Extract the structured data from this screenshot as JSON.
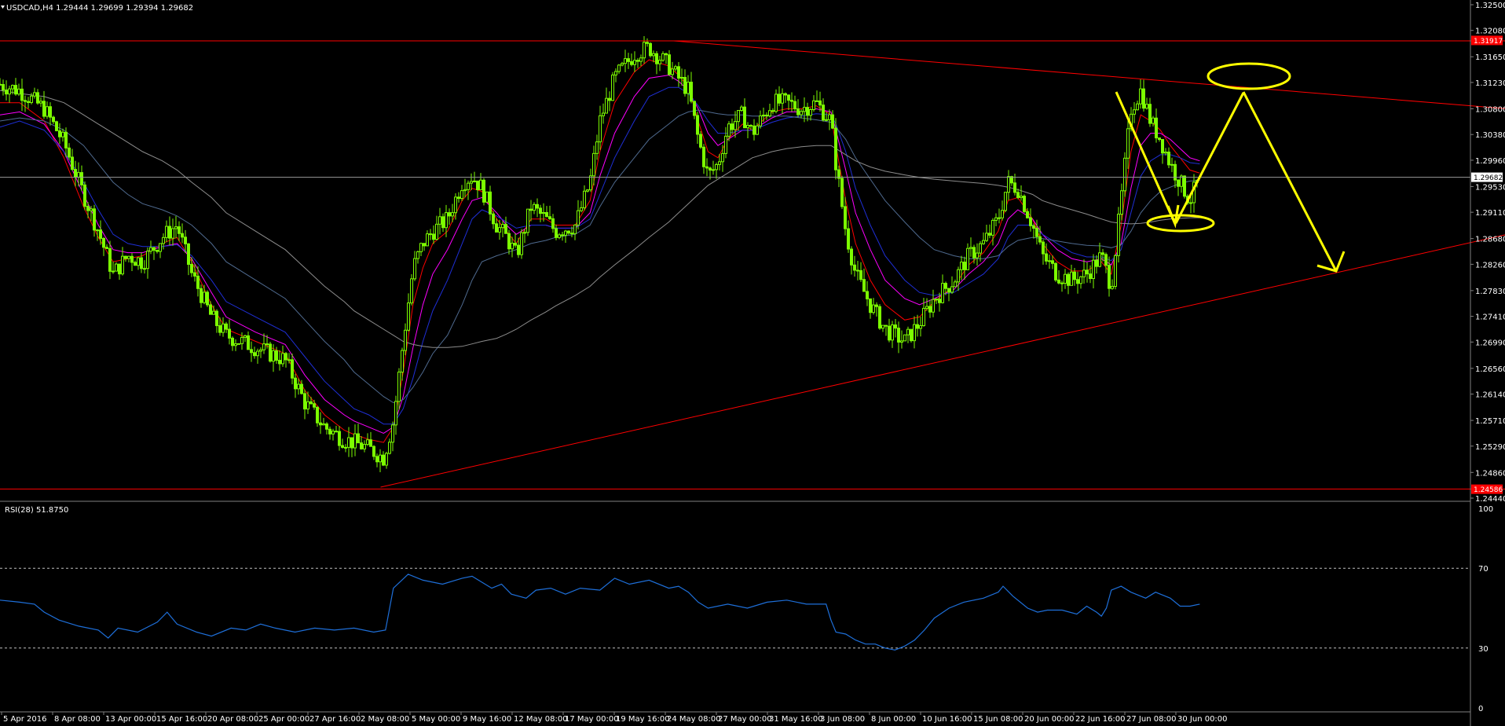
{
  "header": {
    "symbol_info": "USDCAD,H4  1.29444 1.29699 1.29394 1.29682",
    "rsi_info": "RSI(28) 51.8750"
  },
  "colors": {
    "background": "#000000",
    "candle": "#7cfc00",
    "ma_fast": "#ffff00",
    "ma_red": "#ff0000",
    "ma_magenta": "#ff00ff",
    "ma_blue": "#1f2fd6",
    "ma_slate": "#4f6a8f",
    "ma_gray": "#8c8c8c",
    "trendline": "#ff0000",
    "annotation": "#ffff00",
    "rsi": "#1e6fd9",
    "axis": "#808080",
    "price_box": "#ffffff",
    "level_box": "#ff0000"
  },
  "chart_data": [
    {
      "type": "line",
      "title": "USDCAD,H4",
      "ylim": [
        1.2444,
        1.325
      ],
      "yticks": [
        "1.32500",
        "1.32080",
        "1.31650",
        "1.31230",
        "1.30800",
        "1.30380",
        "1.29960",
        "1.29530",
        "1.29110",
        "1.28680",
        "1.28260",
        "1.27830",
        "1.27410",
        "1.26990",
        "1.26560",
        "1.26140",
        "1.25710",
        "1.25290",
        "1.24860",
        "1.24440"
      ],
      "xticks": [
        "5 Apr 2016",
        "8 Apr 08:00",
        "13 Apr 00:00",
        "15 Apr 16:00",
        "20 Apr 08:00",
        "25 Apr 00:00",
        "27 Apr 16:00",
        "2 May 08:00",
        "5 May 00:00",
        "9 May 16:00",
        "12 May 08:00",
        "17 May 00:00",
        "19 May 16:00",
        "24 May 08:00",
        "27 May 00:00",
        "31 May 16:00",
        "3 Jun 08:00",
        "8 Jun 00:00",
        "10 Jun 16:00",
        "15 Jun 08:00",
        "20 Jun 00:00",
        "22 Jun 16:00",
        "27 Jun 08:00",
        "30 Jun 00:00"
      ],
      "current_price_label": "1.29682",
      "upper_level_label": "1.31917",
      "lower_level_label": "1.24586",
      "price_path": {
        "x": [
          0,
          20,
          45,
          65,
          85,
          100,
          115,
          130,
          145,
          165,
          180,
          195,
          215,
          230,
          260,
          290,
          310,
          330,
          350,
          360,
          375,
          390,
          400,
          410,
          420,
          430,
          440,
          455,
          470,
          480,
          490,
          505,
          515,
          525,
          540,
          555,
          565,
          585,
          600,
          610,
          625,
          645,
          660,
          680,
          690,
          700,
          710,
          720,
          730,
          740,
          755,
          765,
          785,
          800,
          815,
          830,
          845,
          850,
          860,
          870,
          885,
          900,
          920,
          935,
          950,
          970,
          985,
          1000,
          1015,
          1025,
          1035,
          1050,
          1060,
          1075,
          1090,
          1105,
          1120,
          1130,
          1140,
          1150,
          1160,
          1170,
          1180,
          1190,
          1200,
          1210,
          1220
        ],
        "y": [
          1.312,
          1.311,
          1.308,
          1.3025,
          1.294,
          1.288,
          1.281,
          1.284,
          1.283,
          1.287,
          1.289,
          1.281,
          1.274,
          1.271,
          1.269,
          1.267,
          1.26,
          1.256,
          1.254,
          1.2535,
          1.2525,
          1.251,
          1.257,
          1.27,
          1.282,
          1.286,
          1.288,
          1.29,
          1.296,
          1.297,
          1.295,
          1.289,
          1.287,
          1.284,
          1.292,
          1.29,
          1.288,
          1.289,
          1.296,
          1.306,
          1.313,
          1.317,
          1.318,
          1.315,
          1.313,
          1.311,
          1.303,
          1.297,
          1.299,
          1.305,
          1.307,
          1.304,
          1.309,
          1.309,
          1.308,
          1.309,
          1.306,
          1.299,
          1.288,
          1.281,
          1.276,
          1.272,
          1.27,
          1.273,
          1.277,
          1.28,
          1.284,
          1.286,
          1.29,
          1.296,
          1.295,
          1.289,
          1.284,
          1.281,
          1.28,
          1.281,
          1.284,
          1.279,
          1.293,
          1.308,
          1.311,
          1.306,
          1.303,
          1.299,
          1.296,
          1.293,
          1.2968
        ]
      },
      "moving_averages": [
        {
          "color_key": "ma_red",
          "y": [
            1.309,
            1.309,
            1.306,
            1.3,
            1.292,
            1.287,
            1.283,
            1.2835,
            1.284,
            1.286,
            1.287,
            1.283,
            1.276,
            1.272,
            1.27,
            1.268,
            1.262,
            1.258,
            1.2555,
            1.2548,
            1.254,
            1.2535,
            1.256,
            1.265,
            1.276,
            1.282,
            1.286,
            1.288,
            1.293,
            1.295,
            1.2945,
            1.29,
            1.288,
            1.286,
            1.29,
            1.29,
            1.289,
            1.289,
            1.293,
            1.301,
            1.309,
            1.314,
            1.316,
            1.315,
            1.3135,
            1.3115,
            1.306,
            1.301,
            1.3,
            1.303,
            1.3055,
            1.3045,
            1.3075,
            1.308,
            1.308,
            1.3085,
            1.307,
            1.302,
            1.293,
            1.286,
            1.28,
            1.276,
            1.2735,
            1.274,
            1.2765,
            1.279,
            1.2825,
            1.2845,
            1.288,
            1.293,
            1.2935,
            1.29,
            1.286,
            1.283,
            1.2815,
            1.2815,
            1.283,
            1.281,
            1.289,
            1.301,
            1.307,
            1.306,
            1.3045,
            1.302,
            1.3,
            1.298,
            1.2975
          ]
        },
        {
          "color_key": "ma_magenta",
          "y": [
            1.307,
            1.3075,
            1.3055,
            1.301,
            1.294,
            1.289,
            1.285,
            1.2845,
            1.2845,
            1.2855,
            1.286,
            1.2835,
            1.278,
            1.274,
            1.2715,
            1.2695,
            1.2645,
            1.2605,
            1.258,
            1.257,
            1.256,
            1.255,
            1.256,
            1.261,
            1.269,
            1.276,
            1.281,
            1.285,
            1.29,
            1.293,
            1.2935,
            1.291,
            1.289,
            1.2875,
            1.289,
            1.289,
            1.2885,
            1.2885,
            1.291,
            1.297,
            1.304,
            1.31,
            1.313,
            1.3135,
            1.3125,
            1.311,
            1.308,
            1.304,
            1.302,
            1.303,
            1.3045,
            1.3045,
            1.3065,
            1.3075,
            1.3075,
            1.308,
            1.3075,
            1.3045,
            1.298,
            1.291,
            1.285,
            1.28,
            1.277,
            1.276,
            1.277,
            1.2785,
            1.281,
            1.283,
            1.286,
            1.29,
            1.2915,
            1.29,
            1.2875,
            1.285,
            1.2835,
            1.283,
            1.2835,
            1.2825,
            1.286,
            1.295,
            1.302,
            1.304,
            1.304,
            1.303,
            1.3015,
            1.3,
            1.2995
          ]
        },
        {
          "color_key": "ma_blue",
          "y": [
            1.305,
            1.306,
            1.3045,
            1.301,
            1.296,
            1.2915,
            1.2875,
            1.286,
            1.2855,
            1.2855,
            1.2858,
            1.284,
            1.28,
            1.2765,
            1.274,
            1.2715,
            1.2675,
            1.2635,
            1.2605,
            1.259,
            1.258,
            1.2565,
            1.2565,
            1.259,
            1.264,
            1.27,
            1.275,
            1.28,
            1.286,
            1.29,
            1.2915,
            1.2905,
            1.2895,
            1.2885,
            1.289,
            1.289,
            1.2885,
            1.2885,
            1.29,
            1.294,
            1.3,
            1.306,
            1.31,
            1.3115,
            1.3115,
            1.3105,
            1.3085,
            1.306,
            1.304,
            1.304,
            1.3045,
            1.3045,
            1.3058,
            1.3065,
            1.3068,
            1.3072,
            1.307,
            1.3055,
            1.301,
            1.295,
            1.289,
            1.284,
            1.28,
            1.278,
            1.2775,
            1.278,
            1.2795,
            1.281,
            1.2835,
            1.287,
            1.289,
            1.289,
            1.2875,
            1.286,
            1.2845,
            1.2838,
            1.2838,
            1.2832,
            1.285,
            1.291,
            1.297,
            1.2995,
            1.3005,
            1.3005,
            1.3,
            1.2992,
            1.299
          ]
        },
        {
          "color_key": "ma_slate",
          "y": [
            1.306,
            1.3065,
            1.306,
            1.3045,
            1.302,
            1.299,
            1.296,
            1.294,
            1.2925,
            1.2915,
            1.2905,
            1.289,
            1.286,
            1.283,
            1.28,
            1.277,
            1.2735,
            1.27,
            1.267,
            1.265,
            1.263,
            1.261,
            1.26,
            1.2605,
            1.2625,
            1.265,
            1.268,
            1.271,
            1.276,
            1.28,
            1.283,
            1.284,
            1.2845,
            1.285,
            1.286,
            1.2865,
            1.287,
            1.2875,
            1.289,
            1.292,
            1.296,
            1.3,
            1.303,
            1.3055,
            1.3068,
            1.3075,
            1.3078,
            1.3075,
            1.3072,
            1.307,
            1.307,
            1.3068,
            1.3068,
            1.3068,
            1.3065,
            1.3062,
            1.3058,
            1.305,
            1.303,
            1.3,
            1.2965,
            1.293,
            1.2895,
            1.287,
            1.285,
            1.284,
            1.2835,
            1.2835,
            1.284,
            1.2855,
            1.2865,
            1.287,
            1.2868,
            1.2864,
            1.286,
            1.2857,
            1.2856,
            1.2853,
            1.2858,
            1.288,
            1.291,
            1.293,
            1.2945,
            1.2952,
            1.2958,
            1.2962,
            1.2963
          ]
        },
        {
          "color_key": "ma_gray",
          "y": [
            1.311,
            1.3105,
            1.31,
            1.309,
            1.307,
            1.3055,
            1.304,
            1.3025,
            1.301,
            1.2995,
            1.298,
            1.296,
            1.2935,
            1.291,
            1.288,
            1.285,
            1.282,
            1.279,
            1.2765,
            1.275,
            1.2735,
            1.272,
            1.271,
            1.27,
            1.2695,
            1.2692,
            1.269,
            1.269,
            1.2692,
            1.2696,
            1.27,
            1.2705,
            1.2712,
            1.272,
            1.2735,
            1.2748,
            1.2758,
            1.2775,
            1.279,
            1.2805,
            1.2825,
            1.285,
            1.287,
            1.2895,
            1.291,
            1.2925,
            1.294,
            1.2955,
            1.2965,
            1.2975,
            1.299,
            1.3,
            1.301,
            1.3015,
            1.3018,
            1.302,
            1.302,
            1.3015,
            1.3005,
            1.2995,
            1.2985,
            1.2978,
            1.2972,
            1.2968,
            1.2965,
            1.2962,
            1.296,
            1.2958,
            1.2955,
            1.2952,
            1.2948,
            1.294,
            1.293,
            1.2922,
            1.2915,
            1.2908,
            1.29,
            1.2895,
            1.2893,
            1.2892,
            1.2893,
            1.2895,
            1.2898,
            1.29,
            1.2901,
            1.2902,
            1.2902
          ]
        }
      ],
      "trendlines": [
        {
          "from": [
            0,
            1.3191
          ],
          "to": [
            1533,
            1.3191
          ],
          "color_key": "ma_red"
        },
        {
          "from": [
            0,
            1.2459
          ],
          "to": [
            1533,
            1.2459
          ],
          "color_key": "ma_red"
        },
        {
          "from": [
            685,
            1.3191
          ],
          "to": [
            1533,
            1.308
          ],
          "color_key": "ma_red"
        },
        {
          "from": [
            387,
            1.2462
          ],
          "to": [
            1533,
            1.2875
          ],
          "color_key": "ma_red"
        }
      ]
    },
    {
      "type": "line",
      "title": "RSI(28) 51.8750",
      "ylim": [
        0,
        100
      ],
      "yticks": [
        "100",
        "70",
        "30",
        "0"
      ],
      "levels": [
        70,
        30
      ],
      "x": [
        0,
        20,
        35,
        45,
        60,
        80,
        100,
        110,
        120,
        140,
        160,
        170,
        180,
        200,
        215,
        235,
        250,
        265,
        280,
        300,
        320,
        340,
        360,
        380,
        392,
        400,
        415,
        430,
        450,
        470,
        480,
        490,
        500,
        510,
        520,
        535,
        545,
        560,
        575,
        590,
        610,
        625,
        640,
        660,
        680,
        690,
        700,
        710,
        720,
        740,
        760,
        780,
        800,
        820,
        840,
        845,
        850,
        860,
        870,
        880,
        890,
        900,
        910,
        920,
        930,
        940,
        950,
        965,
        980,
        1000,
        1015,
        1020,
        1030,
        1045,
        1055,
        1065,
        1080,
        1095,
        1105,
        1115,
        1120,
        1125,
        1130,
        1140,
        1150,
        1165,
        1175,
        1190,
        1200,
        1210,
        1220
      ],
      "y": [
        54,
        53,
        52,
        48,
        44,
        41,
        39,
        35,
        40,
        38,
        43,
        48,
        42,
        38,
        36,
        40,
        39,
        42,
        40,
        38,
        40,
        39,
        40,
        38,
        39,
        60,
        67,
        64,
        62,
        65,
        66,
        63,
        60,
        62,
        57,
        55,
        59,
        60,
        57,
        60,
        59,
        65,
        62,
        64,
        60,
        61,
        58,
        53,
        50,
        52,
        50,
        53,
        54,
        52,
        52,
        44,
        38,
        37,
        34,
        32,
        32,
        30,
        29,
        31,
        34,
        39,
        45,
        50,
        53,
        55,
        58,
        61,
        56,
        50,
        48,
        49,
        49,
        47,
        51,
        48,
        46,
        50,
        59,
        61,
        58,
        55,
        58,
        55,
        51,
        51,
        52
      ]
    }
  ]
}
